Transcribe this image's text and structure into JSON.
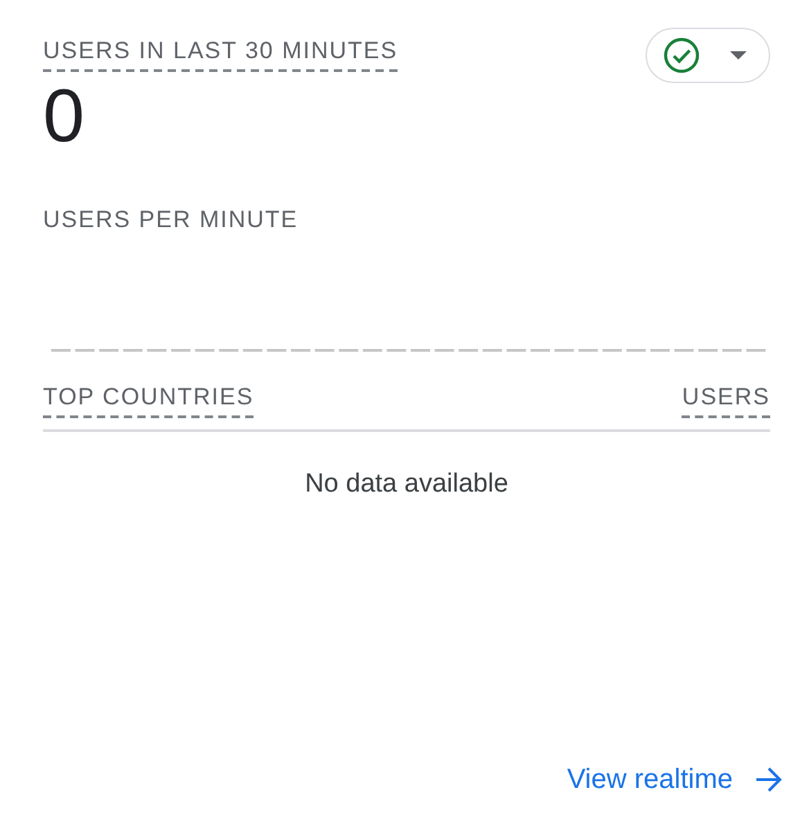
{
  "metric": {
    "title": "USERS IN LAST 30 MINUTES",
    "value": "0"
  },
  "status_menu": {
    "kind": "ok"
  },
  "chart": {
    "title": "USERS PER MINUTE"
  },
  "table": {
    "columns": [
      "TOP COUNTRIES",
      "USERS"
    ],
    "empty_message": "No data available"
  },
  "footer_link": {
    "label": "View realtime"
  }
}
